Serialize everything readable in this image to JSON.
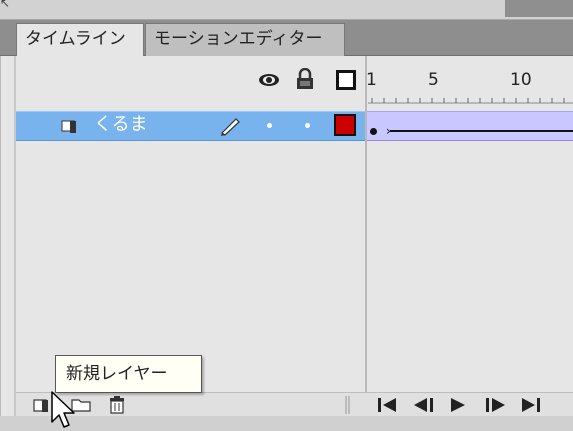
{
  "tabs": [
    {
      "label": "タイムライン",
      "active": true
    },
    {
      "label": "モーションエディター",
      "active": false
    }
  ],
  "header": {
    "icons": [
      "eye-icon",
      "lock-icon",
      "outline-icon"
    ],
    "frame_numbers": [
      "1",
      "5",
      "10"
    ]
  },
  "layer": {
    "name": "くるま",
    "icon": "layer-icon",
    "edit_icon": "pencil-icon",
    "outline_color": "#cc0000",
    "selected_color": "#79b3ee"
  },
  "frames": {
    "keyframe_icon": "keyframe-dot",
    "tween_color": "#c9c7ff"
  },
  "toolbar": {
    "buttons": [
      "new-layer-icon",
      "new-folder-icon",
      "trash-icon"
    ],
    "playback": [
      "go-to-first-icon",
      "step-back-icon",
      "play-icon",
      "step-forward-icon",
      "go-to-last-icon"
    ]
  },
  "tooltip": {
    "text": "新規レイヤー"
  }
}
